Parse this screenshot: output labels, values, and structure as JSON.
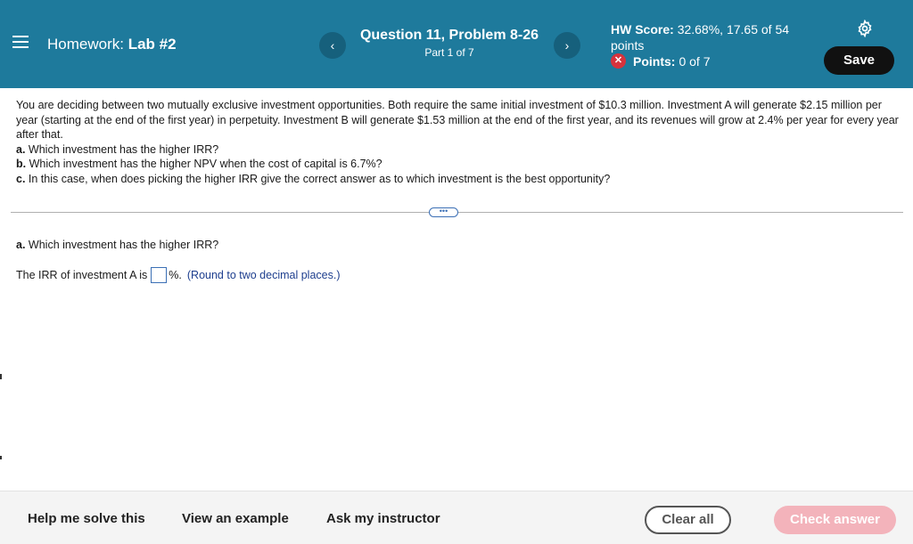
{
  "header": {
    "homework_prefix": "Homework:",
    "homework_name": "Lab #2",
    "question_title": "Question 11, Problem 8-26",
    "question_part": "Part 1 of 7",
    "prev_symbol": "‹",
    "next_symbol": "›",
    "score_label": "HW Score:",
    "score_value": "32.68%, 17.65 of 54",
    "score_unit": "points",
    "points_label": "Points:",
    "points_value": "0 of 7",
    "save_label": "Save"
  },
  "problem": {
    "intro": "You are deciding between two mutually exclusive investment opportunities. Both require the same initial investment of $10.3 million. Investment A will generate $2.15 million per year (starting at the end of the first year) in perpetuity. Investment B will generate $1.53 million at the end of the first year, and its revenues will grow at 2.4% per year for every year after that.",
    "qa_letter": "a.",
    "qa_text": " Which investment has the higher IRR?",
    "qb_letter": "b.",
    "qb_text": " Which investment has the higher NPV when the cost of capital is 6.7%?",
    "qc_letter": "c.",
    "qc_text": " In this case, when does picking the higher IRR give the correct answer as to which investment is the best opportunity?"
  },
  "more_label": "•••",
  "part": {
    "letter": "a.",
    "question": " Which investment has the higher IRR?",
    "answer_prefix": "The IRR of investment A is",
    "answer_suffix": "%.",
    "hint": "(Round to two decimal places.)"
  },
  "footer": {
    "help": "Help me solve this",
    "example": "View an example",
    "ask": "Ask my instructor",
    "clear": "Clear all",
    "check": "Check answer"
  }
}
